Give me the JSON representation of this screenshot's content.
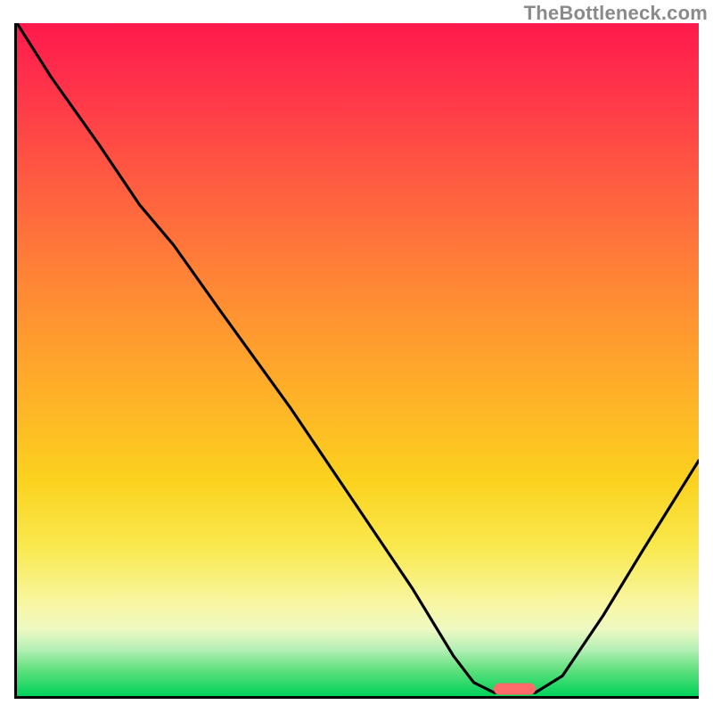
{
  "watermark": "TheBottleneck.com",
  "chart_data": {
    "type": "line",
    "title": "",
    "xlabel": "",
    "ylabel": "",
    "xlim": [
      0,
      100
    ],
    "ylim": [
      0,
      100
    ],
    "gradient_stops": [
      {
        "pct": 0,
        "color": "#ff1a4d"
      },
      {
        "pct": 12,
        "color": "#ff3a49"
      },
      {
        "pct": 25,
        "color": "#ff6040"
      },
      {
        "pct": 40,
        "color": "#ff8a34"
      },
      {
        "pct": 55,
        "color": "#ffb028"
      },
      {
        "pct": 68,
        "color": "#fbd21e"
      },
      {
        "pct": 78,
        "color": "#f9e94f"
      },
      {
        "pct": 86,
        "color": "#f8f6a0"
      },
      {
        "pct": 90,
        "color": "#eef9c2"
      },
      {
        "pct": 93,
        "color": "#b6f0b6"
      },
      {
        "pct": 96,
        "color": "#63e07f"
      },
      {
        "pct": 100,
        "color": "#00d35a"
      }
    ],
    "series": [
      {
        "name": "bottleneck-curve",
        "points": [
          {
            "x": 0,
            "y": 100
          },
          {
            "x": 5,
            "y": 92
          },
          {
            "x": 12,
            "y": 82
          },
          {
            "x": 18,
            "y": 73
          },
          {
            "x": 23,
            "y": 67
          },
          {
            "x": 30,
            "y": 57
          },
          {
            "x": 40,
            "y": 43
          },
          {
            "x": 50,
            "y": 28
          },
          {
            "x": 58,
            "y": 16
          },
          {
            "x": 64,
            "y": 6
          },
          {
            "x": 67,
            "y": 2
          },
          {
            "x": 70,
            "y": 0.5
          },
          {
            "x": 76,
            "y": 0.5
          },
          {
            "x": 80,
            "y": 3
          },
          {
            "x": 86,
            "y": 12
          },
          {
            "x": 92,
            "y": 22
          },
          {
            "x": 100,
            "y": 35
          }
        ]
      }
    ],
    "marker": {
      "x_start": 70,
      "x_end": 76,
      "y": 0,
      "color": "#ff6a6a"
    }
  }
}
